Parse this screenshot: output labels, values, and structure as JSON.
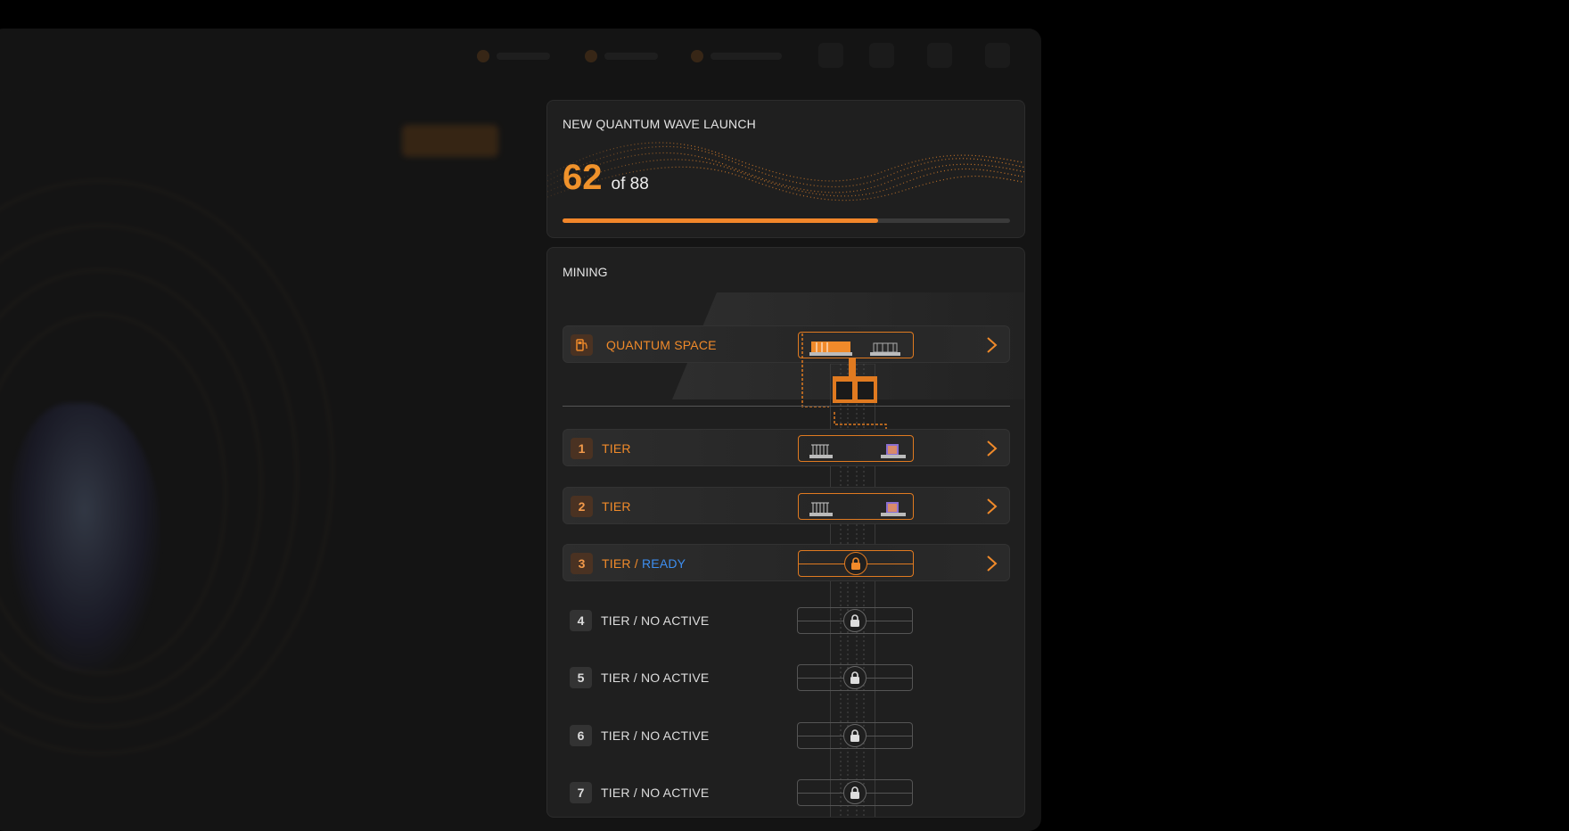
{
  "launch": {
    "title": "NEW QUANTUM WAVE LAUNCH",
    "current": "62",
    "total_text": "of 88",
    "progress_fraction": 0.705,
    "accent": "#f2862a"
  },
  "mining": {
    "title": "MINING",
    "space": {
      "label": "QUANTUM SPACE",
      "icon": "fuel-pump-icon"
    },
    "tiers": [
      {
        "num": "1",
        "label": "TIER",
        "state": "active"
      },
      {
        "num": "2",
        "label": "TIER",
        "state": "active"
      },
      {
        "num": "3",
        "label": "TIER / ",
        "status": "READY",
        "state": "ready"
      },
      {
        "num": "4",
        "label": "TIER / NO ACTIVE",
        "state": "locked"
      },
      {
        "num": "5",
        "label": "TIER / NO ACTIVE",
        "state": "locked"
      },
      {
        "num": "6",
        "label": "TIER / NO ACTIVE",
        "state": "locked"
      },
      {
        "num": "7",
        "label": "TIER / NO ACTIVE",
        "state": "locked"
      }
    ]
  },
  "colors": {
    "orange": "#f08a2a",
    "blue": "#3d8ef0",
    "panel": "#1f1f1f"
  }
}
